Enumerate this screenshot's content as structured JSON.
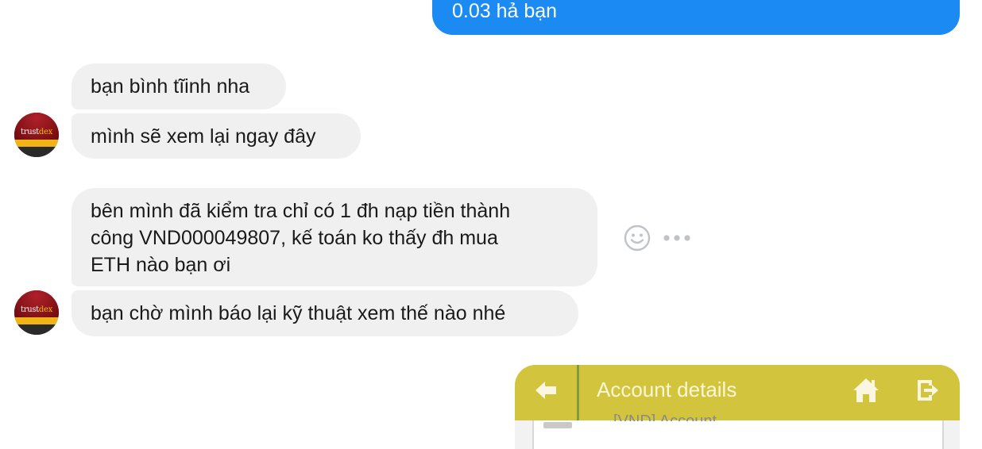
{
  "messages": {
    "outgoing_top": "0.03 hả bạn",
    "incoming_1": "bạn bình tĩinh nha",
    "incoming_2": "mình sẽ xem lại ngay đây",
    "incoming_3_lines": [
      "bên mình đã kiểm tra chỉ có 1 đh nạp tiền thành",
      "công VND000049807, kế toán ko thấy đh mua",
      "ETH nào bạn ơi"
    ],
    "incoming_4": "bạn chờ mình báo lại kỹ thuật xem thế nào nhé"
  },
  "avatar": {
    "logo_part1": "trust",
    "logo_part2": "dex"
  },
  "attachment": {
    "title": "Account details",
    "row_text": "[VND] Account"
  },
  "colors": {
    "outgoing_bubble": "#1b8af2",
    "incoming_bubble": "#f1f0f0",
    "attachment_bar": "#d3c43e"
  },
  "icons": {
    "reaction": "smiley-icon",
    "more": "more-options-icon",
    "back": "back-arrow-icon",
    "home": "home-icon",
    "exit": "exit-icon"
  }
}
